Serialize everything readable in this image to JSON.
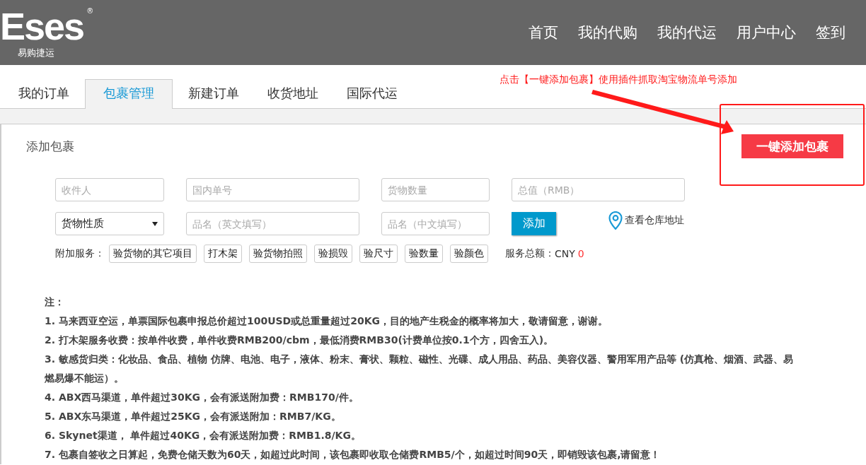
{
  "header": {
    "logo": {
      "mark": "Eses",
      "registered": "®",
      "tagline": "易购捷运"
    },
    "nav": [
      {
        "label": "首页"
      },
      {
        "label": "我的代购"
      },
      {
        "label": "我的代运"
      },
      {
        "label": "用户中心"
      },
      {
        "label": "签到"
      }
    ]
  },
  "tabs": [
    {
      "label": "我的订单",
      "selected": false
    },
    {
      "label": "包裹管理",
      "selected": true
    },
    {
      "label": "新建订单",
      "selected": false
    },
    {
      "label": "收货地址",
      "selected": false
    },
    {
      "label": "国际代运",
      "selected": false
    }
  ],
  "annotation": {
    "text": "点击【一键添加包裹】使用插件抓取淘宝物流单号添加"
  },
  "quick_add_button": "一键添加包裹",
  "panel": {
    "title": "添加包裹",
    "fields": [
      {
        "kind": "input",
        "placeholder": "收件人"
      },
      {
        "kind": "input",
        "placeholder": "国内单号"
      },
      {
        "kind": "input",
        "placeholder": "货物数量"
      },
      {
        "kind": "input",
        "placeholder": "总值（RMB）"
      },
      {
        "kind": "select",
        "value": "货物性质"
      },
      {
        "kind": "input",
        "placeholder": "品名（英文填写）"
      },
      {
        "kind": "input",
        "placeholder": "品名（中文填写）"
      }
    ],
    "add_button": "添加",
    "warehouse_link": "查看仓库地址",
    "services": {
      "label": "附加服务：",
      "options": [
        "验货物的其它项目",
        "打木架",
        "验货物拍照",
        "验损毁",
        "验尺寸",
        "验数量",
        "验颜色"
      ],
      "total_label": "服务总额：",
      "currency": "CNY",
      "total": "0"
    }
  },
  "notes": {
    "heading": "注：",
    "items": [
      "1. 马来西亚空运，单票国际包裹申报总价超过100USD或总重量超过20KG，目的地产生税金的概率将加大，敬请留意，谢谢。",
      "2. 打木架服务收费：按单件收费，单件收费RMB200/cbm，最低消费RMB30(计费单位按0.1个方，四舍五入)。",
      "3. 敏感货归类：化妆品、食品、植物 仿牌、电池、电子，液体、粉末、膏状、颗粒、磁性、光碟、成人用品、药品、美容仪器、警用军用产品等 (仿真枪、烟酒、武器、易燃易爆不能运）。",
      "4. ABX西马渠道，单件超过30KG，会有派送附加费：RMB170/件。",
      "5. ABX东马渠道，单件超过25KG，会有派送附加：RMB7/KG。",
      "6. Skynet渠道， 单件超过40KG，会有派送附加费：RMB1.8/KG。",
      "7. 包裹自签收之日算起，免费仓储天数为60天，如超过此时间，该包裹即收取仓储费RMB5/个，如超过时间90天，即销毁该包裹,请留意！"
    ]
  }
}
